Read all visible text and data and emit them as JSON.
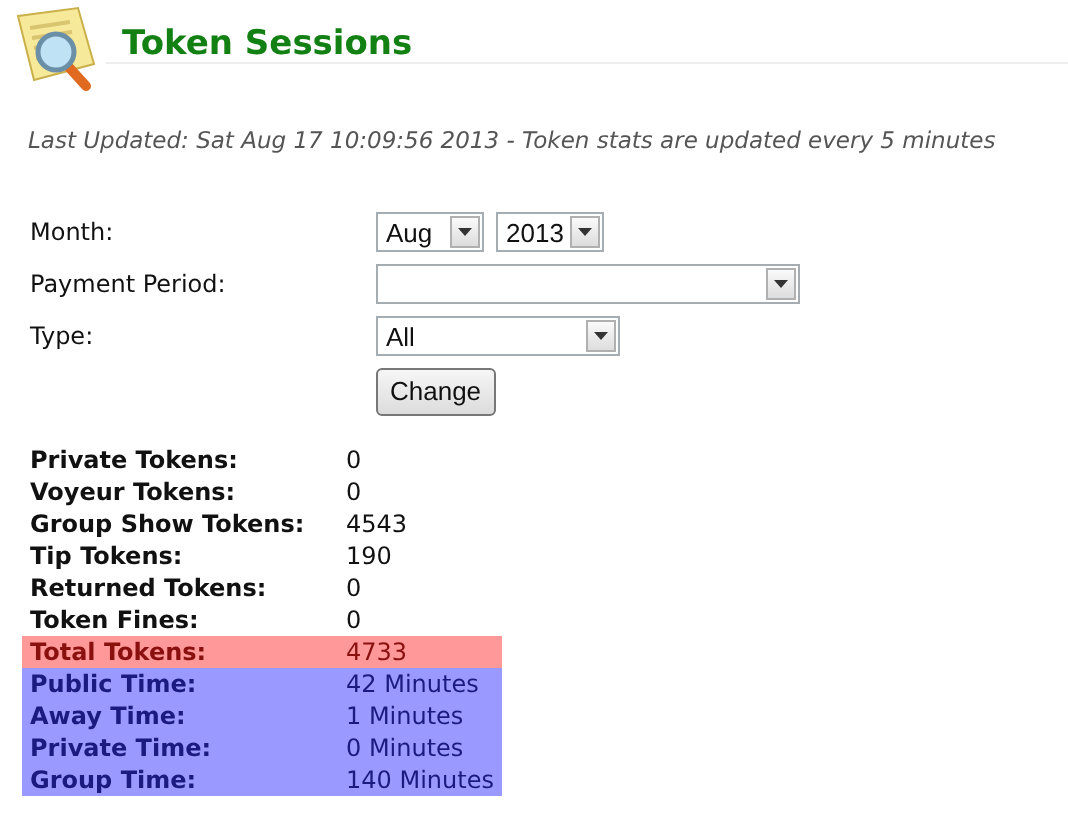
{
  "header": {
    "title": "Token Sessions",
    "updated": "Last Updated: Sat Aug 17 10:09:56 2013 - Token stats are updated every 5 minutes"
  },
  "form": {
    "fields": [
      {
        "label": "Month:",
        "selects": [
          {
            "value": "Aug"
          },
          {
            "value": "2013"
          }
        ]
      },
      {
        "label": "Payment Period:",
        "empty_select": true
      },
      {
        "label": "Type:",
        "selects": [
          {
            "value": "All"
          }
        ]
      }
    ],
    "button": "Change"
  },
  "stats": [
    {
      "label": "Private Tokens:",
      "value": "0",
      "kind": "plain"
    },
    {
      "label": "Voyeur Tokens:",
      "value": "0",
      "kind": "plain"
    },
    {
      "label": "Group Show Tokens:",
      "value": "4543",
      "kind": "plain"
    },
    {
      "label": "Tip Tokens:",
      "value": "190",
      "kind": "plain"
    },
    {
      "label": "Returned Tokens:",
      "value": "0",
      "kind": "plain"
    },
    {
      "label": "Token Fines:",
      "value": "0",
      "kind": "plain"
    },
    {
      "label": "Total Tokens:",
      "value": "4733",
      "kind": "total"
    },
    {
      "label": "Public Time:",
      "value": "42 Minutes",
      "kind": "time"
    },
    {
      "label": "Away Time:",
      "value": "1 Minutes",
      "kind": "time"
    },
    {
      "label": "Private Time:",
      "value": "0 Minutes",
      "kind": "time"
    },
    {
      "label": "Group Time:",
      "value": "140 Minutes",
      "kind": "time"
    }
  ]
}
